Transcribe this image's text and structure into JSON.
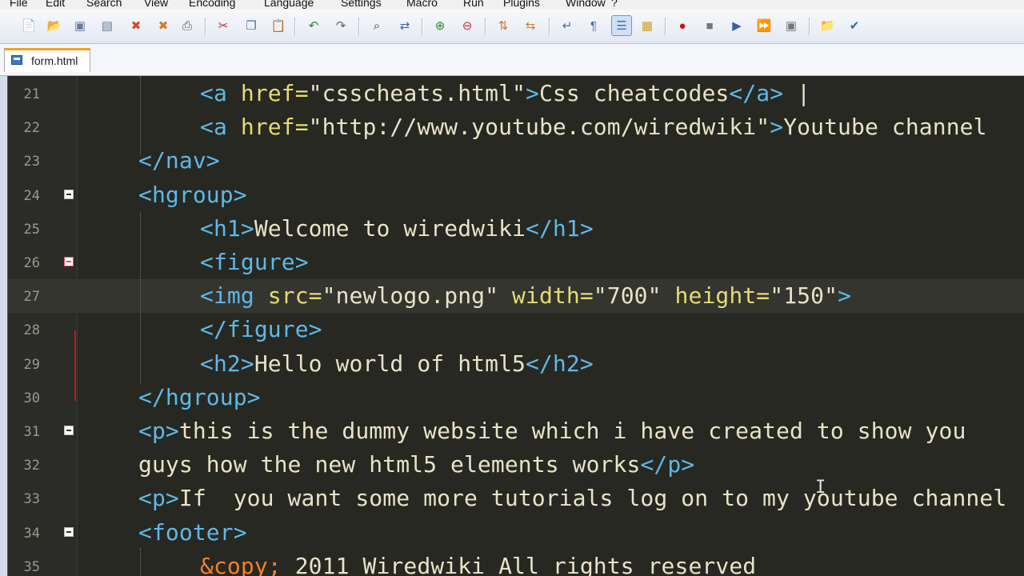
{
  "menu": [
    "File",
    "Edit",
    "Search",
    "View",
    "Encoding",
    "Language",
    "Settings",
    "Macro",
    "Run",
    "Plugins",
    "Window",
    "?"
  ],
  "toolbar": {
    "icons": [
      "new-file-icon",
      "open-file-icon",
      "save-icon",
      "save-all-icon",
      "close-icon",
      "close-all-icon",
      "print-icon",
      "cut-icon",
      "copy-icon",
      "paste-icon",
      "undo-icon",
      "redo-icon",
      "find-icon",
      "replace-icon",
      "zoom-in-icon",
      "zoom-out-icon",
      "sync-vertical-icon",
      "sync-horizontal-icon",
      "word-wrap-icon",
      "show-all-chars-icon",
      "indent-guide-icon",
      "doc-map-icon",
      "record-macro-icon",
      "stop-record-icon",
      "play-macro-icon",
      "run-multiple-macro-icon",
      "save-macro-icon",
      "open-folder-icon",
      "spellcheck-icon"
    ]
  },
  "tab": {
    "label": "form.html",
    "icon": "saved-file-icon"
  },
  "editor": {
    "colors": {
      "background": "#272822",
      "tag": "#5fb8e8",
      "attribute": "#e6db74",
      "text": "#e8e3c8",
      "entity": "#f08030"
    },
    "current_line": "27",
    "lines": [
      {
        "num": "21",
        "indent": 2,
        "fold": "",
        "segs": [
          [
            "tag",
            "<a "
          ],
          [
            "attr",
            "href="
          ],
          [
            "val",
            "\"csscheats.html\""
          ],
          [
            "tag",
            ">"
          ],
          [
            "txt",
            "Css cheatcodes"
          ],
          [
            "tag",
            "</a>"
          ],
          [
            "txt",
            " |"
          ]
        ]
      },
      {
        "num": "22",
        "indent": 2,
        "fold": "",
        "segs": [
          [
            "tag",
            "<a "
          ],
          [
            "attr",
            "href="
          ],
          [
            "val",
            "\"http://www.youtube.com/wiredwiki\""
          ],
          [
            "tag",
            ">"
          ],
          [
            "txt",
            "Youtube channel"
          ]
        ]
      },
      {
        "num": "23",
        "indent": 1,
        "fold": "",
        "segs": [
          [
            "tag",
            "</nav>"
          ]
        ]
      },
      {
        "num": "24",
        "indent": 1,
        "fold": "box",
        "segs": [
          [
            "tag",
            "<hgroup>"
          ]
        ]
      },
      {
        "num": "25",
        "indent": 2,
        "fold": "",
        "segs": [
          [
            "tag",
            "<h1>"
          ],
          [
            "txt",
            "Welcome to wiredwiki"
          ],
          [
            "tag",
            "</h1>"
          ]
        ]
      },
      {
        "num": "26",
        "indent": 2,
        "fold": "red",
        "segs": [
          [
            "tag",
            "<figure>"
          ]
        ]
      },
      {
        "num": "27",
        "indent": 2,
        "fold": "",
        "segs": [
          [
            "tag",
            "<img "
          ],
          [
            "attr",
            "src="
          ],
          [
            "val",
            "\"newlogo.png\" "
          ],
          [
            "attr",
            "width="
          ],
          [
            "val",
            "\"700\" "
          ],
          [
            "attr",
            "height="
          ],
          [
            "val",
            "\"150\""
          ],
          [
            "tag",
            ">"
          ]
        ]
      },
      {
        "num": "28",
        "indent": 2,
        "fold": "",
        "segs": [
          [
            "tag",
            "</figure>"
          ]
        ]
      },
      {
        "num": "29",
        "indent": 2,
        "fold": "",
        "segs": [
          [
            "tag",
            "<h2>"
          ],
          [
            "txt",
            "Hello world of html5"
          ],
          [
            "tag",
            "</h2>"
          ]
        ]
      },
      {
        "num": "30",
        "indent": 1,
        "fold": "",
        "segs": [
          [
            "tag",
            "</hgroup>"
          ]
        ]
      },
      {
        "num": "31",
        "indent": 1,
        "fold": "box",
        "segs": [
          [
            "tag",
            "<p>"
          ],
          [
            "txt",
            "this is the dummy website which i have created to show you"
          ]
        ]
      },
      {
        "num": "32",
        "indent": 1,
        "fold": "",
        "segs": [
          [
            "txt",
            "guys how the new html5 elements works"
          ],
          [
            "tag",
            "</p>"
          ]
        ]
      },
      {
        "num": "33",
        "indent": 1,
        "fold": "",
        "segs": [
          [
            "tag",
            "<p>"
          ],
          [
            "txt",
            "If  you want some more tutorials log on to my youtube channel"
          ]
        ]
      },
      {
        "num": "34",
        "indent": 1,
        "fold": "box",
        "segs": [
          [
            "tag",
            "<footer>"
          ]
        ]
      },
      {
        "num": "35",
        "indent": 2,
        "fold": "",
        "segs": [
          [
            "ent",
            "&copy;"
          ],
          [
            "txt",
            " 2011 Wiredwiki All rights reserved"
          ]
        ]
      }
    ]
  }
}
